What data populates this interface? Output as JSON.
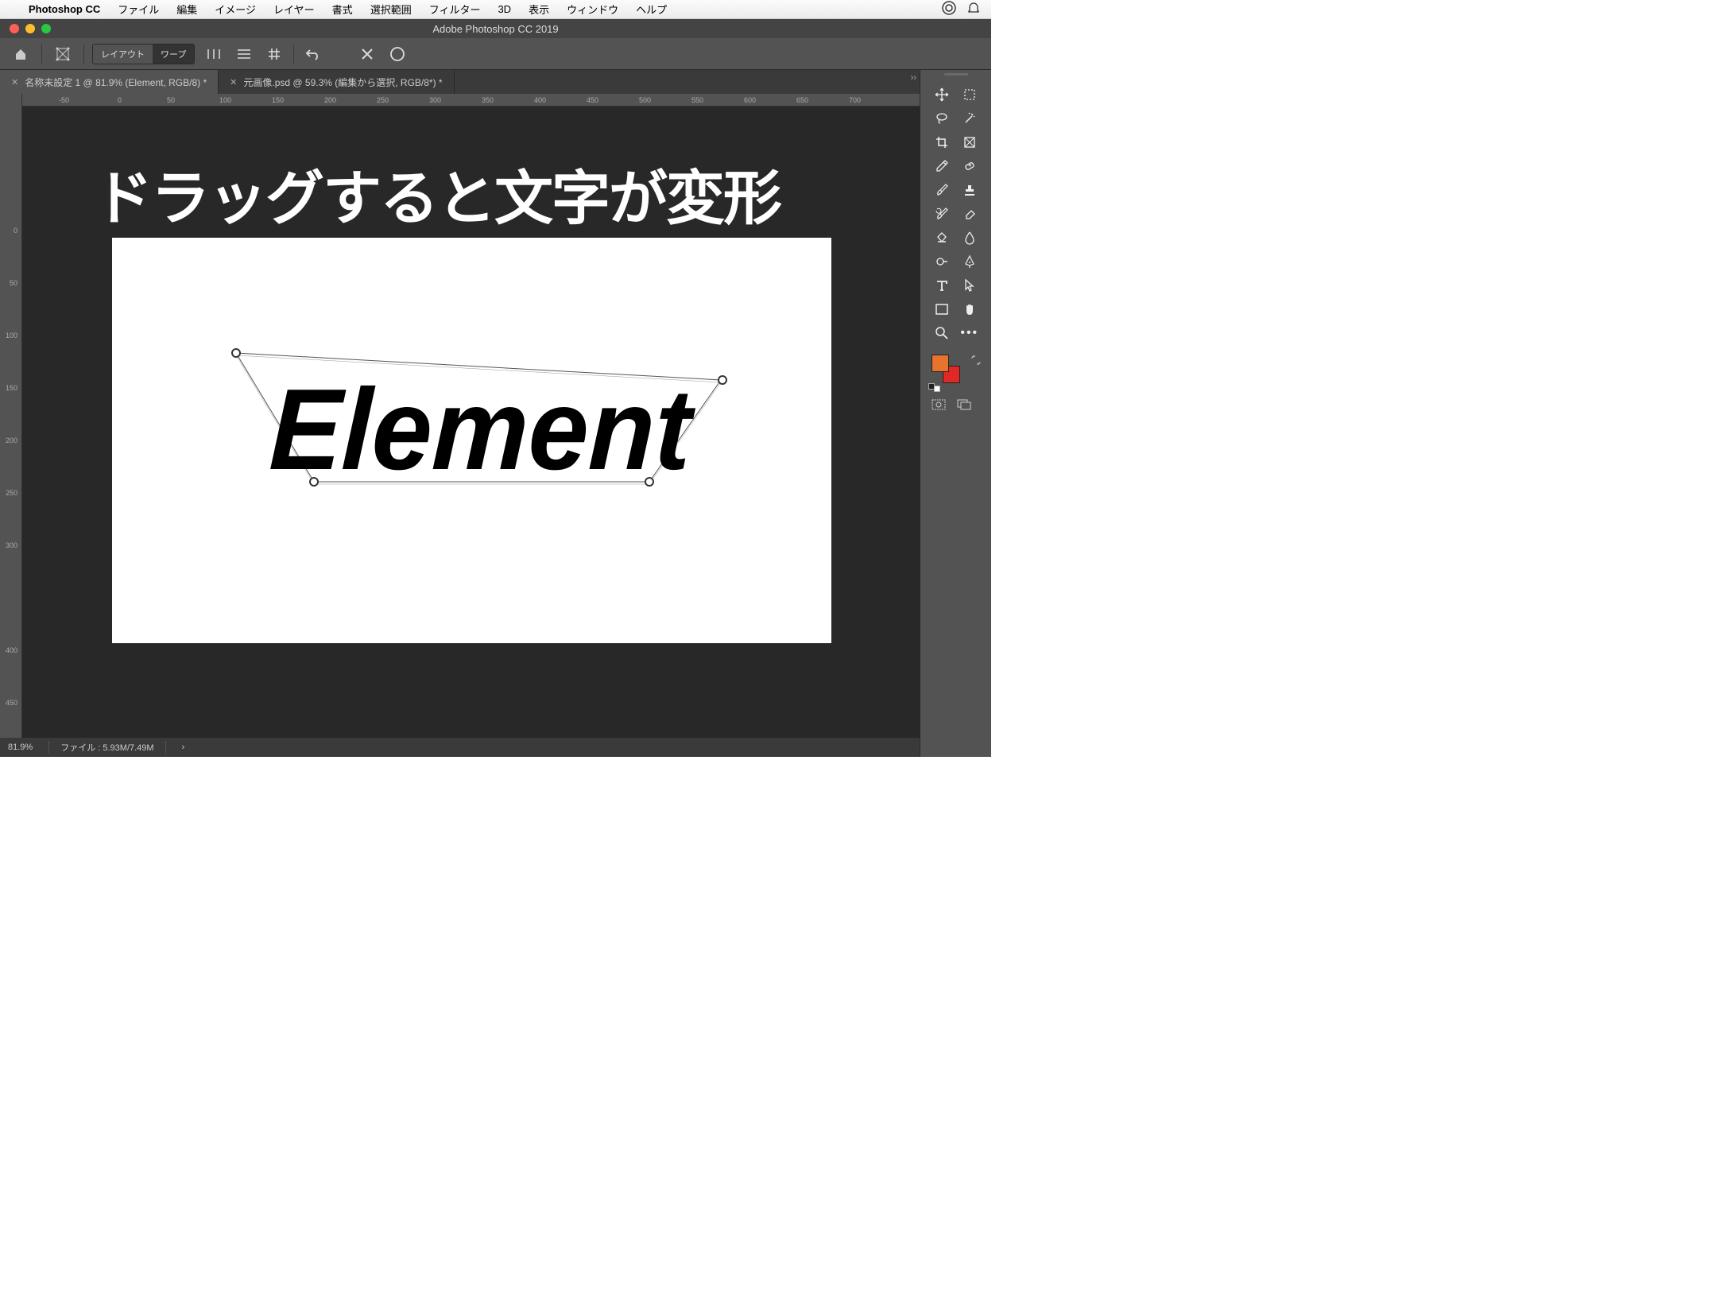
{
  "menubar": {
    "app": "Photoshop CC",
    "items": [
      "ファイル",
      "編集",
      "イメージ",
      "レイヤー",
      "書式",
      "選択範囲",
      "フィルター",
      "3D",
      "表示",
      "ウィンドウ",
      "ヘルプ"
    ]
  },
  "window": {
    "title": "Adobe Photoshop CC 2019"
  },
  "options": {
    "layout_label": "レイアウト",
    "warp_label": "ワープ"
  },
  "tabs": [
    {
      "label": "名称未設定 1 @ 81.9% (Element, RGB/8) *"
    },
    {
      "label": "元画像.psd @ 59.3% (編集から選択, RGB/8*) *"
    }
  ],
  "hruler": [
    "-50",
    "0",
    "50",
    "100",
    "150",
    "200",
    "250",
    "300",
    "350",
    "400",
    "450",
    "500",
    "550",
    "600",
    "650",
    "700"
  ],
  "vruler": [
    "0",
    "50",
    "100",
    "150",
    "200",
    "250",
    "300",
    "400",
    "450"
  ],
  "overlay_text": "ドラッグすると文字が変形",
  "canvas_text": "Element",
  "swatches": {
    "fg": "#e8732c",
    "bg": "#e02826"
  },
  "status": {
    "zoom": "81.9%",
    "filesize": "ファイル : 5.93M/7.49M",
    "chev": "›"
  },
  "tool_names": [
    "move",
    "marquee",
    "lasso",
    "wand",
    "crop",
    "frame",
    "eyedropper",
    "heal",
    "brush",
    "stamp",
    "history",
    "eraser",
    "bucket",
    "blur",
    "dodge",
    "pen",
    "type",
    "select",
    "shape",
    "hand",
    "zoom",
    "more"
  ]
}
